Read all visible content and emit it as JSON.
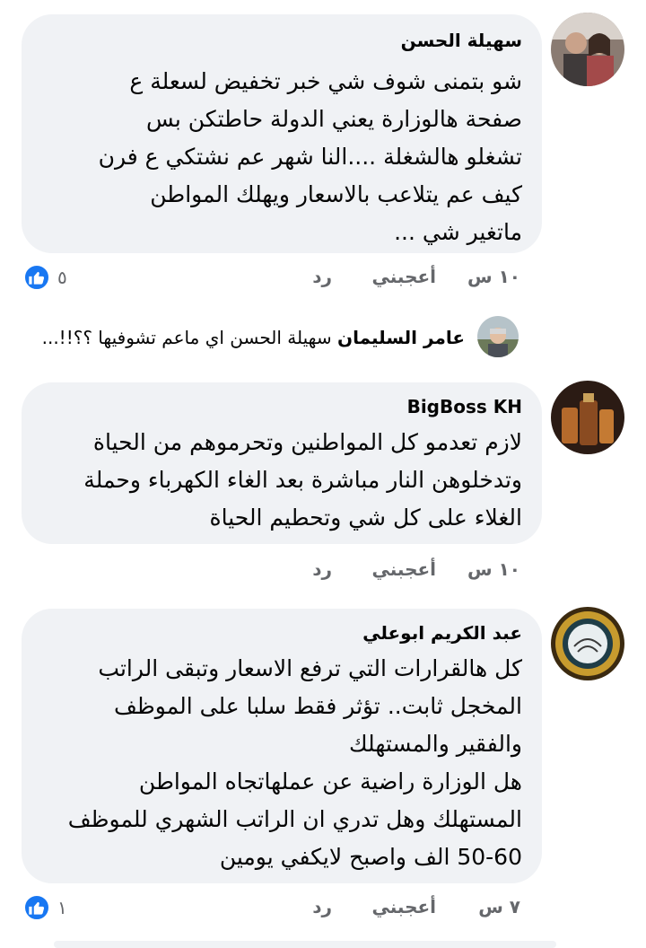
{
  "comments": [
    {
      "author": "سهيلة الحسن",
      "text": "شو بتمنى شوف شي خبر تخفيض لسعلة ع\nصفحة هالوزارة يعني الدولة حاطتكن بس\nتشغلو هالشغلة ....النا شهر عم نشتكي ع فرن\nكيف عم يتلاعب بالاسعار ويهلك المواطن\nماتغير شي ...",
      "time": "١٠ س",
      "like": "أعجبني",
      "reply": "رد",
      "reactions": "٥"
    },
    {
      "author": "BigBoss KH",
      "text": "لازم تعدمو كل المواطنين وتحرموهم من الحياة\nوتدخلوهن النار مباشرة بعد الغاء الكهرباء وحملة\nالغلاء على كل شي وتحطيم الحياة",
      "time": "١٠ س",
      "like": "أعجبني",
      "reply": "رد"
    },
    {
      "author": "عبد الكريم ابوعلي",
      "text": "كل هالقرارات التي ترفع الاسعار وتبقى الراتب\nالمخجل ثابت.. تؤثر فقط سلبا على الموظف\nوالفقير والمستهلك\nهل الوزارة راضية عن عملهاتجاه المواطن\nالمستهلك وهل تدري ان الراتب الشهري للموظف\n50-60 الف واصبح لايكفي يومين",
      "time": "٧ س",
      "like": "أعجبني",
      "reply": "رد",
      "reactions": "١"
    }
  ],
  "reply_preview": {
    "author": "عامر السليمان",
    "text": "سهيلة الحسن اي ماعم تشوفيها ؟؟!!..."
  },
  "colors": {
    "bubble": "#f0f2f5",
    "like_blue": "#1877f2",
    "meta_gray": "#65676b"
  }
}
